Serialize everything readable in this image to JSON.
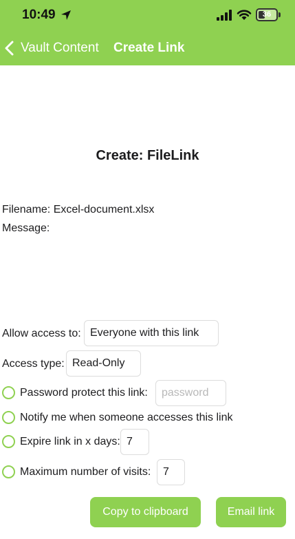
{
  "status_bar": {
    "time": "10:49",
    "battery_percent": "36",
    "battery_level": 0.36,
    "icons": [
      "location-arrow-icon",
      "cellular-signal-icon",
      "wifi-icon",
      "battery-icon"
    ]
  },
  "nav": {
    "back_label": "Vault Content",
    "title": "Create Link"
  },
  "page": {
    "title": "Create: FileLink",
    "filename": "Filename: Excel-document.xlsx",
    "message_label": "Message:"
  },
  "form": {
    "allow_access_label": "Allow access to:",
    "allow_access_value": "Everyone with this link",
    "access_type_label": "Access type:",
    "access_type_value": "Read-Only",
    "password_label": "Password protect this link:",
    "password_placeholder": "password",
    "notify_label": "Notify me when someone accesses this link",
    "expire_label": "Expire link in x days:",
    "expire_value": "7",
    "max_visits_label": "Maximum number of visits:",
    "max_visits_value": "7"
  },
  "buttons": {
    "copy_label": "Copy to clipboard",
    "email_label": "Email link"
  },
  "colors": {
    "accent": "#8fd151",
    "background": "#ffffff",
    "text": "#1c1c1e",
    "placeholder": "#b8b8b8",
    "field_border": "#dcdcdc"
  }
}
